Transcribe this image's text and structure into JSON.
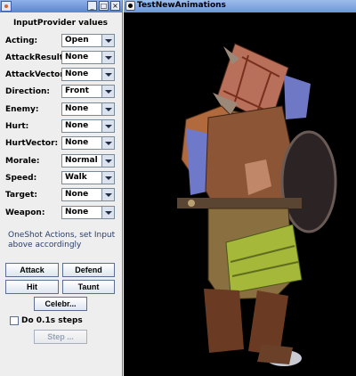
{
  "left_window": {
    "min_glyph": "_",
    "max_glyph": "□",
    "close_glyph": "×",
    "icon": "java-cup-icon"
  },
  "panel": {
    "title": "InputProvider values",
    "fields": [
      {
        "label": "Acting:",
        "value": "Open"
      },
      {
        "label": "AttackResult:",
        "value": "None"
      },
      {
        "label": "AttackVector:",
        "value": "None"
      },
      {
        "label": "Direction:",
        "value": "Front"
      },
      {
        "label": "Enemy:",
        "value": "None"
      },
      {
        "label": "Hurt:",
        "value": "None"
      },
      {
        "label": "HurtVector:",
        "value": "None"
      },
      {
        "label": "Morale:",
        "value": "Normal"
      },
      {
        "label": "Speed:",
        "value": "Walk"
      },
      {
        "label": "Target:",
        "value": "None"
      },
      {
        "label": "Weapon:",
        "value": "None"
      }
    ],
    "info": "OneShot Actions, set Input above accordingly",
    "buttons": {
      "attack": "Attack",
      "defend": "Defend",
      "hit": "Hit",
      "taunt": "Taunt",
      "celebrate": "Celebr...",
      "step": "Step ..."
    },
    "checkbox_label": "Do 0.1s steps"
  },
  "render_window": {
    "title": "TestNewAnimations"
  },
  "colors": {
    "panel_bg": "#eeeeee",
    "titlebar": "#6f96d9",
    "viewport_bg": "#000000"
  }
}
